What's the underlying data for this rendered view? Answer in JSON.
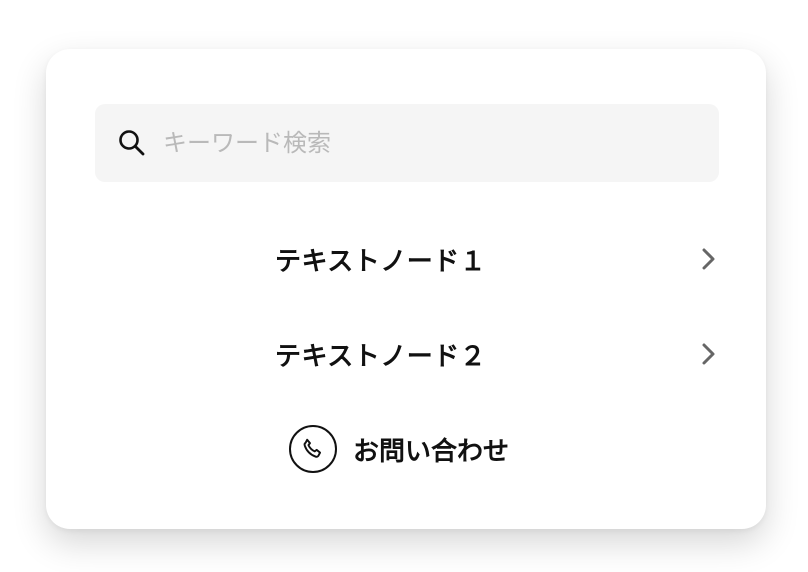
{
  "search": {
    "placeholder": "キーワード検索",
    "value": "",
    "icon": "search-icon"
  },
  "menu": {
    "items": [
      {
        "label": "テキストノード１",
        "icon": "chevron-right-icon"
      },
      {
        "label": "テキストノード２",
        "icon": "chevron-right-icon"
      }
    ]
  },
  "contact": {
    "label": "お問い合わせ",
    "icon": "phone-icon"
  },
  "colors": {
    "text": "#111111",
    "placeholder": "#b9b9b9",
    "search_bg": "#f5f5f5",
    "chevron": "#666666"
  }
}
